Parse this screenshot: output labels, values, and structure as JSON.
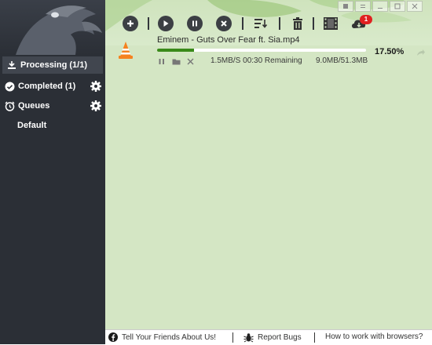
{
  "sidebar": {
    "items": [
      {
        "label": "Processing (1/1)",
        "icon": "download-tray-icon"
      },
      {
        "label": "Completed (1)",
        "icon": "check-circle-icon"
      },
      {
        "label": "Queues",
        "icon": "alarm-clock-icon"
      },
      {
        "label": "Default"
      }
    ]
  },
  "toolbar": {
    "buttons": [
      "add-icon",
      "play-icon",
      "pause-icon",
      "stop-icon",
      "sort-icon",
      "trash-icon",
      "video-icon",
      "cloud-download-icon"
    ],
    "notification_count": "1"
  },
  "download": {
    "filename": "Eminem - Guts Over Fear ft. Sia.mp4",
    "progress_percent": 17.5,
    "progress_label": "17.50%",
    "speed_remaining": "1.5MB/S 00:30 Remaining",
    "size": "9.0MB/51.3MB"
  },
  "footer": {
    "share": "Tell Your Friends About Us!",
    "bugs": "Report Bugs",
    "help": "How to work with browsers?"
  },
  "colors": {
    "sidebar_bg": "#2b2f36",
    "main_bg": "#d4e6c4",
    "progress_fill": "#3a8a1a",
    "badge": "#e02020"
  }
}
